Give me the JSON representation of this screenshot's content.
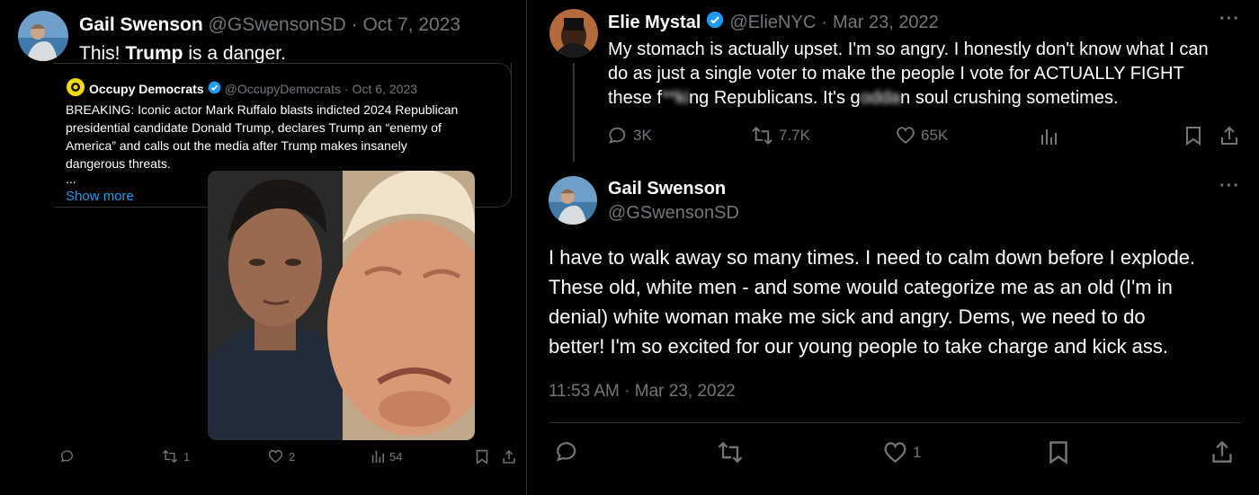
{
  "left_tweet": {
    "author_name": "Gail Swenson",
    "handle": "@GSwensonSD",
    "sep": "·",
    "date": "Oct 7, 2023",
    "text_before": "This! ",
    "text_bold": "Trump",
    "text_after": " is a danger.",
    "quote": {
      "author_name": "Occupy Democrats",
      "handle": "@OccupyDemocrats",
      "sep": "·",
      "date": "Oct 6, 2023",
      "line1": "BREAKING: Iconic actor Mark Ruffalo blasts indicted 2024 Republican",
      "line2": "presidential candidate Donald Trump, declares Trump an “enemy of",
      "line3": "America” and calls out the media after Trump makes insanely",
      "line4": "dangerous threats.",
      "ellipsis": "...",
      "show_more": "Show more"
    },
    "actions": {
      "retweets": "1",
      "likes": "2",
      "views": "54"
    }
  },
  "right_top_tweet": {
    "author_name": "Elie Mystal",
    "handle": "@ElieNYC",
    "sep": "·",
    "date": "Mar 23, 2022",
    "more": "···",
    "line1": "My stomach is actually upset. I'm so angry. I honestly don't know what I can",
    "line2": "do as just a single voter to make the people I vote for ACTUALLY FIGHT",
    "line3_a": "these f",
    "line3_b": "**ki",
    "line3_c": "ng Republicans. It's g",
    "line3_d": "odda",
    "line3_e": "n soul crushing sometimes.",
    "actions": {
      "replies": "3K",
      "retweets": "7.7K",
      "likes": "65K"
    }
  },
  "right_main_tweet": {
    "author_name": "Gail Swenson",
    "handle": "@GSwensonSD",
    "more": "···",
    "line1": "I have to walk away so many times. I need to calm down before I explode.",
    "line2": "These old, white men - and some would categorize me as an old (I'm in",
    "line3": "denial) white woman make me sick and angry. Dems, we need to do",
    "line4": "better! I'm so excited for our young people to take charge and kick ass.",
    "timestamp": "11:53 AM · Mar 23, 2022",
    "actions": {
      "likes": "1"
    }
  },
  "colors": {
    "link": "#1d9bf0",
    "muted": "#71767b",
    "verified": "#1d9bf0",
    "occupy_badge": "#f5d90a"
  },
  "icons": [
    "reply-icon",
    "retweet-icon",
    "like-icon",
    "views-icon",
    "bookmark-icon",
    "share-icon",
    "verified-icon",
    "more-icon"
  ]
}
